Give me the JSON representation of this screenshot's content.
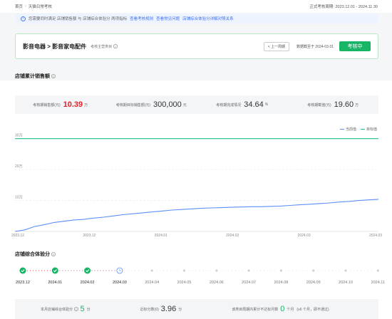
{
  "breadcrumb": {
    "home": "首页",
    "current": "天猫日常考核"
  },
  "period": "正式考核周期: 2023.12.01 - 2024.11.30",
  "notice": {
    "text": "您需要同时满足 店铺销售额 与 店铺综合体验分 两项指标",
    "links": [
      "查看考核规则",
      "查看常见问题",
      "店铺综合体验分详解对照关系"
    ]
  },
  "category": {
    "path": "影音电器 > 影音家电配件",
    "sub_label": "考核主营类目",
    "prev_button": "上一周期",
    "deadline": "数据截至于 2024-03-31",
    "status": "考核中"
  },
  "sales_section": {
    "title": "店铺累计销售额"
  },
  "metrics": [
    {
      "label": "考核期销售额(元)",
      "value": "10.39",
      "unit": "万",
      "highlight": true
    },
    {
      "label": "考核期目标销售额(元)",
      "value": "300,000",
      "unit": "元",
      "highlight": false
    },
    {
      "label": "考核期完成情况",
      "value": "34.64",
      "unit": "%",
      "highlight": false
    },
    {
      "label": "考核期截值(元)",
      "value": "19.60",
      "unit": "万",
      "highlight": false
    }
  ],
  "legend": [
    {
      "name": "当前值",
      "color": "#5b8ff9"
    },
    {
      "name": "目标值",
      "color": "#1fbf85"
    }
  ],
  "chart_data": {
    "type": "line",
    "y_ticks": [
      "30万",
      "20万",
      "10万"
    ],
    "x_ticks": [
      "2023.12",
      "2023.12",
      "2024.01",
      "2024.02",
      "2024.03",
      "2024.03"
    ],
    "ylim": [
      0,
      32
    ],
    "series": [
      {
        "name": "目标值",
        "color": "#1fbf85",
        "values": [
          30,
          30
        ]
      },
      {
        "name": "当前值",
        "color": "#5b8ff9",
        "values": [
          0,
          0.5,
          1.6,
          2.2,
          2.9,
          3.3,
          3.7,
          3.9,
          4.3,
          4.6,
          5.0,
          5.4,
          5.7,
          6.0,
          6.3,
          6.6,
          6.9,
          7.1,
          7.3,
          7.5,
          7.6,
          7.7,
          7.8,
          7.9,
          8.0,
          8.0,
          8.1,
          8.2,
          8.4,
          8.6,
          8.8,
          9.0,
          9.2,
          9.5,
          9.7,
          10.0,
          10.2,
          10.39
        ]
      }
    ]
  },
  "score_section": {
    "title": "店铺综合体验分"
  },
  "months": [
    {
      "label": "2023.12",
      "status": "pass"
    },
    {
      "label": "2024.01",
      "status": "pass"
    },
    {
      "label": "2024.02",
      "status": "pass"
    },
    {
      "label": "2024.03",
      "status": "current"
    },
    {
      "label": "2024.04",
      "status": "future"
    },
    {
      "label": "2024.05",
      "status": "future"
    },
    {
      "label": "2024.06",
      "status": "future"
    },
    {
      "label": "2024.07",
      "status": "future"
    },
    {
      "label": "2024.08",
      "status": "future"
    },
    {
      "label": "2024.09",
      "status": "future"
    },
    {
      "label": "2024.10",
      "status": "future"
    },
    {
      "label": "2024.11",
      "status": "future"
    }
  ],
  "score_summary": {
    "current_label": "本月店铺综合体验分",
    "current_value": "5",
    "current_unit": "分",
    "recent_label": "近标分数(0)",
    "recent_value": "3.96",
    "recent_unit": "分",
    "fail_label": "该类目周期内累计不达标月数",
    "fail_value": "0",
    "fail_unit": "个月",
    "fail_note": "(≥6 个月，即不通过)"
  },
  "colors": {
    "green": "#18b566",
    "blue": "#5b8ff9",
    "red": "#e0202a"
  }
}
